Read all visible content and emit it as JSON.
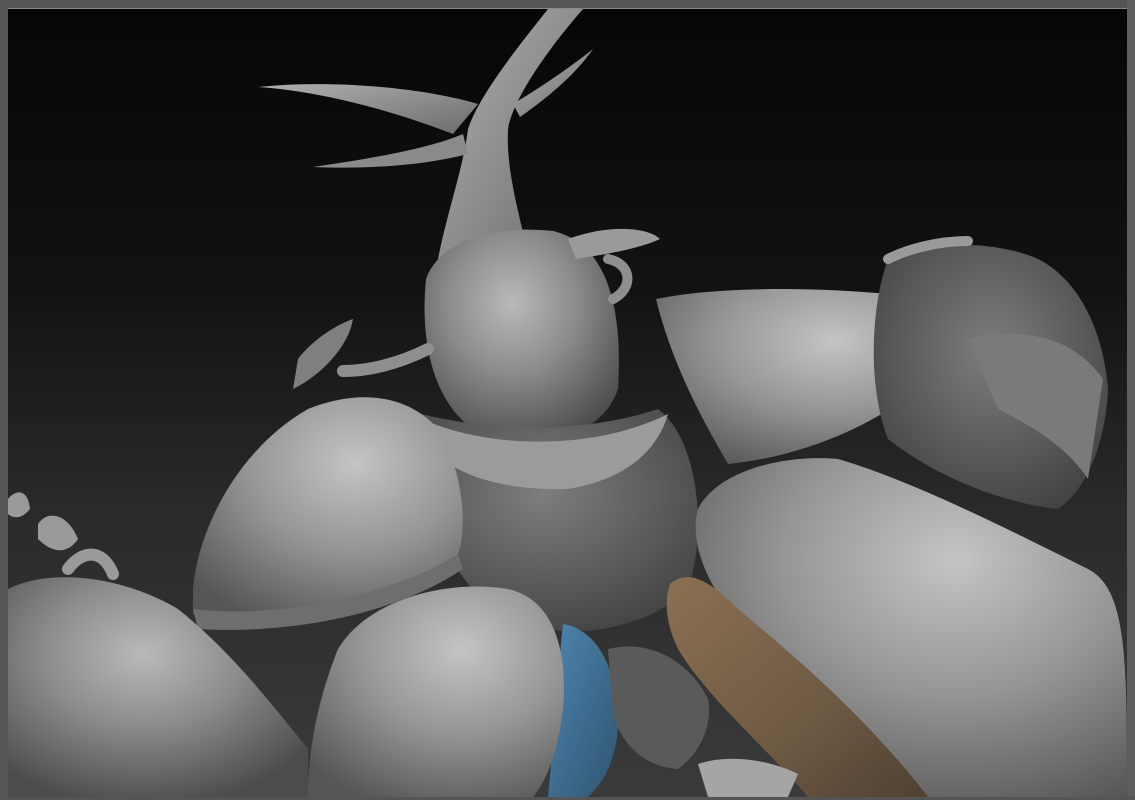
{
  "app": {
    "name": "",
    "document_title": ""
  },
  "viewport": {
    "background_top": "#060606",
    "background_bottom": "#3a3a3a",
    "model": {
      "subject": "beetle-warrior-sculpt",
      "base_material_color": "#8c8c8c",
      "accent_colors": [
        "#3f6f96",
        "#7a6248"
      ]
    }
  }
}
